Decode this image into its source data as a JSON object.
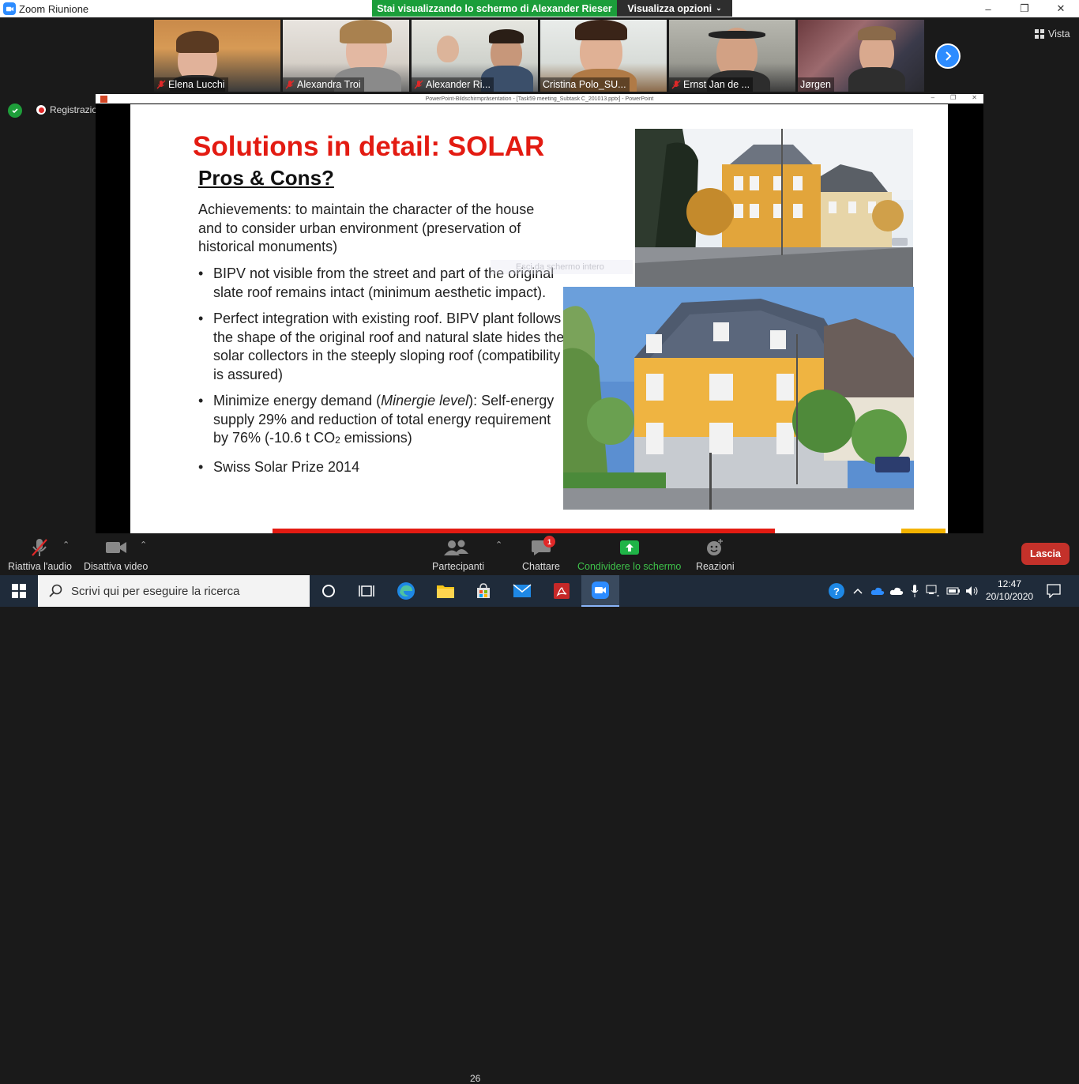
{
  "window": {
    "title": "Zoom Riunione",
    "share_banner": "Stai visualizzando lo schermo di Alexander Rieser",
    "view_options": "Visualizza opzioni",
    "vista": "Vista",
    "recording": "Registrazione"
  },
  "participants": [
    {
      "name": "Elena Lucchi"
    },
    {
      "name": "Alexandra Troi"
    },
    {
      "name": "Alexander Ri..."
    },
    {
      "name": "Cristina Polo_SU..."
    },
    {
      "name": "Ernst Jan de ..."
    },
    {
      "name": "Jørgen"
    }
  ],
  "shared_window": {
    "title": "PowerPoint-Bildschirmpräsentation - [Task59 meeting_Subtask C_201013.pptx] - PowerPoint",
    "ghost_text": "Esci da schermo intero"
  },
  "slide": {
    "title": "Solutions in detail: SOLAR",
    "subtitle": "Pros & Cons?",
    "achievements": "Achievements: to maintain the character of the house and to consider urban environment (preservation of historical monuments)",
    "bullet1": "BIPV not visible from the street and part of the original slate roof remains intact (minimum aesthetic impact).",
    "bullet2": "Perfect integration with existing roof. BIPV plant follows the shape of the original roof and natural slate hides the solar collectors in the steeply sloping roof (compatibility is assured)",
    "bullet3_a": "Minimize energy demand (",
    "bullet3_b": "Minergie level",
    "bullet3_c": "): Self-energy supply 29% and reduction of total energy requirement by 76% (-10.6 t CO",
    "bullet3_sub": "2",
    "bullet3_d": " emissions)",
    "bullet4": "Swiss Solar Prize 2014"
  },
  "toolbar": {
    "audio": "Riattiva l'audio",
    "video": "Disattiva video",
    "participants": "Partecipanti",
    "participants_count": "26",
    "chat": "Chattare",
    "chat_badge": "1",
    "share": "Condividere lo schermo",
    "reactions": "Reazioni",
    "leave": "Lascia"
  },
  "taskbar": {
    "search_placeholder": "Scrivi qui per eseguire la ricerca",
    "time": "12:47",
    "date": "20/10/2020"
  },
  "colors": {
    "accent_green": "#1b9e3a",
    "zoom_blue": "#2d8cff",
    "slide_red": "#e31b12",
    "leave_red": "#c4312a"
  }
}
